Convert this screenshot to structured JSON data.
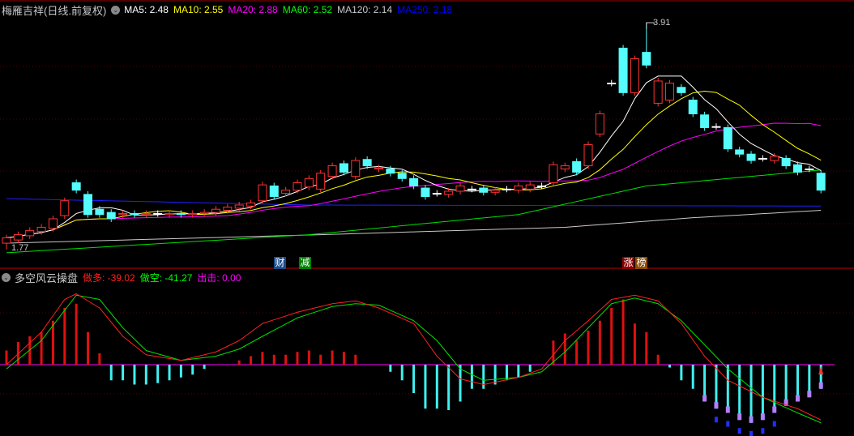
{
  "header": {
    "title": "梅雁吉祥(日线.前复权)",
    "ma": [
      {
        "label": "MA5: 2.48",
        "color": "#ffffff"
      },
      {
        "label": "MA10: 2.55",
        "color": "#ffff00"
      },
      {
        "label": "MA20: 2.88",
        "color": "#ff00ff"
      },
      {
        "label": "MA60: 2.52",
        "color": "#00ff00"
      },
      {
        "label": "MA120: 2.14",
        "color": "#c8c8c8"
      },
      {
        "label": "MA250: 2.18",
        "color": "#0000ff"
      }
    ]
  },
  "price_labels": {
    "high": "3.91",
    "low": "1.77"
  },
  "tags": [
    {
      "text": "财",
      "bg": "#1a4a8a"
    },
    {
      "text": "减",
      "bg": "#008000"
    },
    {
      "text": "涨",
      "bg": "#8b0000"
    },
    {
      "text": "榜",
      "bg": "#8b4a00"
    }
  ],
  "indicator": {
    "title": "多空风云操盘",
    "long_label": "做多: -39.02",
    "short_label": "做空: -41.27",
    "strike_label": "出击: 0.00",
    "long_color": "#ff2020",
    "short_color": "#00ff00",
    "strike_color": "#ff00ff"
  },
  "chart_data": {
    "type": "candlestick",
    "high_value": 3.91,
    "low_value": 1.77,
    "candles_open_close": [
      [
        1.83,
        1.88
      ],
      [
        1.86,
        1.91
      ],
      [
        1.9,
        1.95
      ],
      [
        1.94,
        1.98
      ],
      [
        1.97,
        2.06
      ],
      [
        2.09,
        2.23
      ],
      [
        2.4,
        2.33
      ],
      [
        2.29,
        2.1
      ],
      [
        2.15,
        2.1
      ],
      [
        2.12,
        2.06
      ],
      [
        2.1,
        2.11
      ],
      [
        2.11,
        2.1
      ],
      [
        2.1,
        2.11
      ],
      [
        2.11,
        2.11
      ],
      [
        2.1,
        2.11
      ],
      [
        2.11,
        2.1
      ],
      [
        2.1,
        2.11
      ],
      [
        2.11,
        2.12
      ],
      [
        2.12,
        2.15
      ],
      [
        2.14,
        2.17
      ],
      [
        2.16,
        2.19
      ],
      [
        2.18,
        2.21
      ],
      [
        2.23,
        2.38
      ],
      [
        2.37,
        2.27
      ],
      [
        2.3,
        2.33
      ],
      [
        2.33,
        2.4
      ],
      [
        2.36,
        2.44
      ],
      [
        2.34,
        2.49
      ],
      [
        2.46,
        2.56
      ],
      [
        2.58,
        2.5
      ],
      [
        2.46,
        2.61
      ],
      [
        2.62,
        2.56
      ],
      [
        2.53,
        2.54
      ],
      [
        2.53,
        2.49
      ],
      [
        2.49,
        2.44
      ],
      [
        2.44,
        2.37
      ],
      [
        2.35,
        2.27
      ],
      [
        2.3,
        2.3
      ],
      [
        2.29,
        2.32
      ],
      [
        2.32,
        2.37
      ],
      [
        2.34,
        2.34
      ],
      [
        2.35,
        2.31
      ],
      [
        2.31,
        2.33
      ],
      [
        2.34,
        2.34
      ],
      [
        2.33,
        2.37
      ],
      [
        2.34,
        2.38
      ],
      [
        2.37,
        2.37
      ],
      [
        2.4,
        2.57
      ],
      [
        2.53,
        2.56
      ],
      [
        2.6,
        2.5
      ],
      [
        2.56,
        2.76
      ],
      [
        2.86,
        3.05
      ],
      [
        3.34,
        3.34
      ],
      [
        3.67,
        3.25
      ],
      [
        3.25,
        3.57
      ],
      [
        3.63,
        3.51
      ],
      [
        3.15,
        3.36
      ],
      [
        3.18,
        3.34
      ],
      [
        3.3,
        3.25
      ],
      [
        3.18,
        3.05
      ],
      [
        3.04,
        2.92
      ],
      [
        2.93,
        2.93
      ],
      [
        2.92,
        2.72
      ],
      [
        2.71,
        2.67
      ],
      [
        2.67,
        2.61
      ],
      [
        2.63,
        2.63
      ],
      [
        2.61,
        2.65
      ],
      [
        2.63,
        2.56
      ],
      [
        2.57,
        2.5
      ],
      [
        2.53,
        2.53
      ],
      [
        2.49,
        2.33
      ]
    ],
    "ma60_anchors": [
      [
        0,
        1.74
      ],
      [
        26,
        1.91
      ],
      [
        44,
        2.1
      ],
      [
        55,
        2.37
      ],
      [
        70,
        2.52
      ]
    ],
    "ma120_anchors": [
      [
        0,
        1.83
      ],
      [
        27,
        1.91
      ],
      [
        48,
        1.98
      ],
      [
        59,
        2.07
      ],
      [
        70,
        2.14
      ]
    ],
    "ma250_anchors": [
      [
        0,
        2.25
      ],
      [
        26,
        2.19
      ],
      [
        70,
        2.18
      ]
    ],
    "indicator_bars": [
      10,
      16,
      20,
      23,
      31,
      40,
      43,
      23,
      8,
      -11,
      -11,
      -14,
      -14,
      -13,
      -11,
      -9,
      -7,
      -3,
      0,
      0,
      3,
      6,
      9,
      7,
      7,
      9,
      10,
      7,
      10,
      9,
      7,
      0,
      0,
      -5,
      -11,
      -20,
      -31,
      -31,
      -32,
      -26,
      -17,
      -17,
      -14,
      -11,
      -9,
      -5,
      0,
      17,
      22,
      17,
      24,
      31,
      40,
      46,
      29,
      23,
      7,
      -2,
      -11,
      -17,
      -26,
      -31,
      -34,
      -39,
      -41,
      -39,
      -34,
      -29,
      -26,
      -23,
      -17
    ],
    "long_line_anchors": [
      [
        0,
        0
      ],
      [
        3,
        23
      ],
      [
        5,
        46
      ],
      [
        6,
        50
      ],
      [
        8,
        40
      ],
      [
        10,
        20
      ],
      [
        12,
        7
      ],
      [
        15,
        3
      ],
      [
        18,
        9
      ],
      [
        20,
        17
      ],
      [
        22,
        29
      ],
      [
        25,
        37
      ],
      [
        28,
        43
      ],
      [
        30,
        45
      ],
      [
        32,
        40
      ],
      [
        35,
        29
      ],
      [
        37,
        6
      ],
      [
        39,
        -10
      ],
      [
        41,
        -14
      ],
      [
        44,
        -9
      ],
      [
        46,
        -3
      ],
      [
        48,
        17
      ],
      [
        50,
        31
      ],
      [
        52,
        46
      ],
      [
        54,
        49
      ],
      [
        56,
        45
      ],
      [
        58,
        29
      ],
      [
        60,
        6
      ],
      [
        62,
        -11
      ],
      [
        65,
        -23
      ],
      [
        68,
        -31
      ],
      [
        70,
        -39
      ]
    ],
    "short_line_anchors": [
      [
        0,
        -3
      ],
      [
        3,
        17
      ],
      [
        6,
        49
      ],
      [
        8,
        46
      ],
      [
        10,
        26
      ],
      [
        12,
        10
      ],
      [
        15,
        3
      ],
      [
        18,
        6
      ],
      [
        20,
        11
      ],
      [
        22,
        20
      ],
      [
        25,
        33
      ],
      [
        28,
        41
      ],
      [
        30,
        43
      ],
      [
        32,
        42
      ],
      [
        35,
        31
      ],
      [
        37,
        17
      ],
      [
        39,
        -3
      ],
      [
        41,
        -11
      ],
      [
        44,
        -9
      ],
      [
        46,
        -5
      ],
      [
        48,
        9
      ],
      [
        50,
        26
      ],
      [
        52,
        43
      ],
      [
        54,
        47
      ],
      [
        56,
        43
      ],
      [
        58,
        31
      ],
      [
        60,
        14
      ],
      [
        62,
        -3
      ],
      [
        65,
        -23
      ],
      [
        68,
        -34
      ],
      [
        70,
        -41
      ]
    ]
  }
}
